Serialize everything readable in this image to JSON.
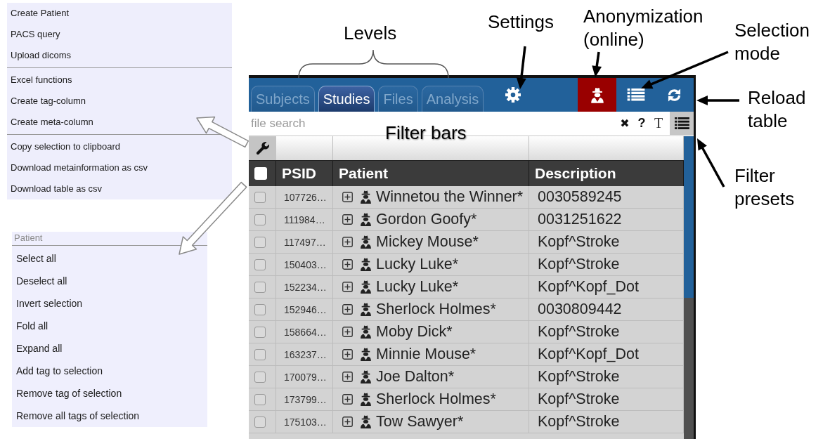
{
  "actions_menu": {
    "groups": [
      [
        "Create Patient",
        "PACS query",
        "Upload dicoms"
      ],
      [
        "Excel functions",
        "Create tag-column",
        "Create meta-column"
      ],
      [
        "Copy selection to clipboard",
        "Download metainformation as csv",
        "Download table as csv"
      ]
    ]
  },
  "context_menu": {
    "title": "Patient",
    "items": [
      "Select all",
      "Deselect all",
      "Invert selection",
      "Fold all",
      "Expand all",
      "Add tag to selection",
      "Remove tag of selection",
      "Remove all tags of selection"
    ]
  },
  "app": {
    "tabs": [
      {
        "label": "Subjects",
        "selected": false
      },
      {
        "label": "Studies",
        "selected": true
      },
      {
        "label": "Files",
        "selected": false
      },
      {
        "label": "Analysis",
        "selected": false
      }
    ],
    "anonymization": {
      "on": true
    },
    "search": {
      "placeholder": "file search"
    },
    "search_tools": [
      "✖",
      "?",
      "T"
    ],
    "table": {
      "all_checked": false,
      "columns": [
        "PSID",
        "Patient",
        "Description"
      ],
      "rows": [
        {
          "psid": "107726…",
          "patient": "Winnetou the Winner*",
          "description": "0030589245",
          "checked": false,
          "expanded": false
        },
        {
          "psid": "111984…",
          "patient": "Gordon Goofy*",
          "description": "0031251622",
          "checked": false,
          "expanded": false
        },
        {
          "psid": "117497…",
          "patient": "Mickey Mouse*",
          "description": "Kopf^Stroke",
          "checked": false,
          "expanded": false
        },
        {
          "psid": "150403…",
          "patient": "Lucky Luke*",
          "description": "Kopf^Stroke",
          "checked": false,
          "expanded": false
        },
        {
          "psid": "152234…",
          "patient": "Lucky Luke*",
          "description": "Kopf^Kopf_Dot",
          "checked": false,
          "expanded": false
        },
        {
          "psid": "152946…",
          "patient": "Sherlock Holmes*",
          "description": "0030809442",
          "checked": false,
          "expanded": false
        },
        {
          "psid": "158664…",
          "patient": "Moby Dick*",
          "description": "Kopf^Stroke",
          "checked": false,
          "expanded": false
        },
        {
          "psid": "163237…",
          "patient": "Minnie Mouse*",
          "description": "Kopf^Kopf_Dot",
          "checked": false,
          "expanded": false
        },
        {
          "psid": "170079…",
          "patient": "Joe Dalton*",
          "description": "Kopf^Stroke",
          "checked": false,
          "expanded": false
        },
        {
          "psid": "173799…",
          "patient": "Sherlock Holmes*",
          "description": "Kopf^Stroke",
          "checked": false,
          "expanded": false
        },
        {
          "psid": "175103…",
          "patient": "Tow Sawyer*",
          "description": "Kopf^Stroke",
          "checked": false,
          "expanded": false
        }
      ]
    }
  },
  "callouts": [
    "Levels",
    "Settings",
    "Anonymization (online)",
    "Selection mode",
    "Reload table",
    "Filter bars",
    "Filter presets"
  ]
}
